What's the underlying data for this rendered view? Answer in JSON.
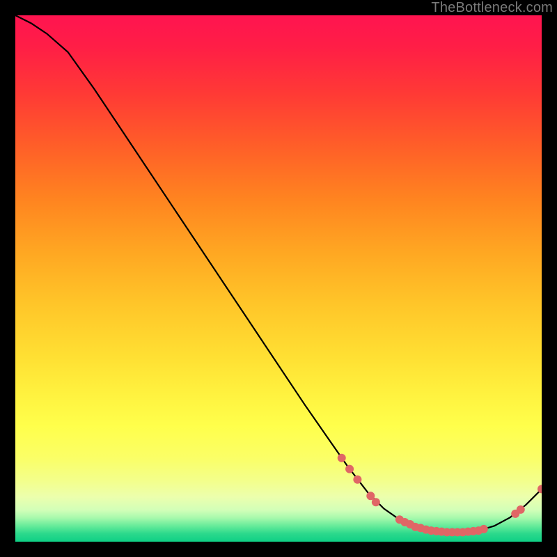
{
  "watermark": "TheBottleneck.com",
  "chart_data": {
    "type": "line",
    "title": "",
    "xlabel": "",
    "ylabel": "",
    "xlim": [
      0,
      100
    ],
    "ylim": [
      0,
      100
    ],
    "x": [
      0,
      3,
      6,
      10,
      15,
      20,
      25,
      30,
      35,
      40,
      45,
      50,
      55,
      60,
      63,
      67,
      70,
      73,
      76,
      79,
      82,
      85,
      88,
      91,
      94,
      97,
      100
    ],
    "y": [
      100,
      98.5,
      96.5,
      93,
      86,
      78.5,
      71,
      63.5,
      56,
      48.5,
      41,
      33.5,
      26,
      18.8,
      14.5,
      9.3,
      6.3,
      4.2,
      2.8,
      2.1,
      1.8,
      1.8,
      2.1,
      3.0,
      4.6,
      7.0,
      10.0
    ],
    "markers": [
      {
        "x": 62.0,
        "y": 15.9
      },
      {
        "x": 63.5,
        "y": 13.8
      },
      {
        "x": 65.0,
        "y": 11.8
      },
      {
        "x": 67.5,
        "y": 8.7
      },
      {
        "x": 68.5,
        "y": 7.5
      },
      {
        "x": 73.0,
        "y": 4.2
      },
      {
        "x": 74.0,
        "y": 3.7
      },
      {
        "x": 75.0,
        "y": 3.3
      },
      {
        "x": 76.0,
        "y": 2.8
      },
      {
        "x": 77.0,
        "y": 2.6
      },
      {
        "x": 78.0,
        "y": 2.3
      },
      {
        "x": 79.0,
        "y": 2.1
      },
      {
        "x": 80.0,
        "y": 2.0
      },
      {
        "x": 81.0,
        "y": 1.9
      },
      {
        "x": 82.0,
        "y": 1.8
      },
      {
        "x": 83.0,
        "y": 1.8
      },
      {
        "x": 84.0,
        "y": 1.8
      },
      {
        "x": 85.0,
        "y": 1.8
      },
      {
        "x": 86.0,
        "y": 1.9
      },
      {
        "x": 87.0,
        "y": 2.0
      },
      {
        "x": 88.0,
        "y": 2.1
      },
      {
        "x": 89.0,
        "y": 2.4
      },
      {
        "x": 95.0,
        "y": 5.3
      },
      {
        "x": 96.0,
        "y": 6.1
      },
      {
        "x": 100.0,
        "y": 10.0
      }
    ],
    "marker_color": "#e06666",
    "line_color": "#000000",
    "gradient_stops": [
      {
        "offset": 0.0,
        "color": "#ff1450"
      },
      {
        "offset": 0.06,
        "color": "#ff1e46"
      },
      {
        "offset": 0.15,
        "color": "#ff3a35"
      },
      {
        "offset": 0.25,
        "color": "#ff5f28"
      },
      {
        "offset": 0.35,
        "color": "#ff8420"
      },
      {
        "offset": 0.45,
        "color": "#ffa722"
      },
      {
        "offset": 0.55,
        "color": "#ffc629"
      },
      {
        "offset": 0.65,
        "color": "#ffe033"
      },
      {
        "offset": 0.72,
        "color": "#fff23f"
      },
      {
        "offset": 0.78,
        "color": "#ffff4b"
      },
      {
        "offset": 0.84,
        "color": "#fbff66"
      },
      {
        "offset": 0.885,
        "color": "#f3ff8c"
      },
      {
        "offset": 0.915,
        "color": "#ecffad"
      },
      {
        "offset": 0.94,
        "color": "#d2ffb8"
      },
      {
        "offset": 0.955,
        "color": "#a6f9ac"
      },
      {
        "offset": 0.97,
        "color": "#66eb9a"
      },
      {
        "offset": 0.985,
        "color": "#2bd98c"
      },
      {
        "offset": 1.0,
        "color": "#0fcf85"
      }
    ]
  }
}
